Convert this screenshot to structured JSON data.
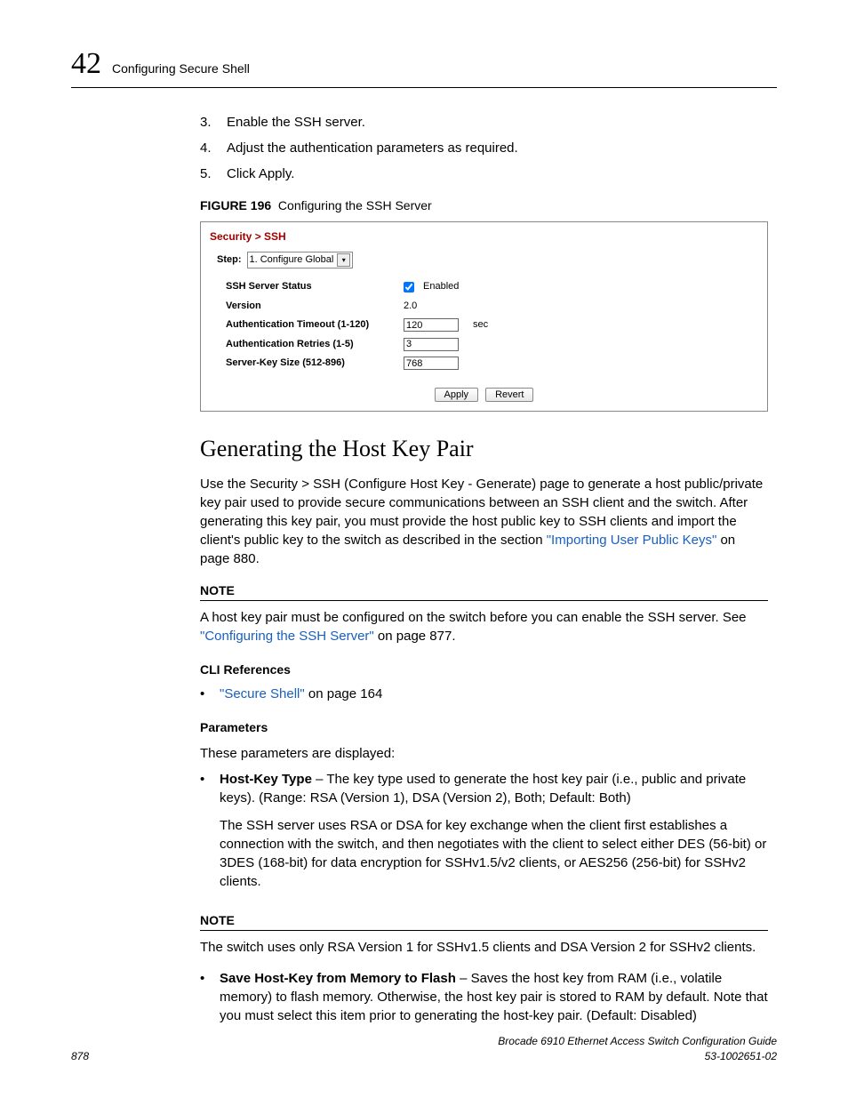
{
  "header": {
    "chapter_number": "42",
    "chapter_title": "Configuring Secure Shell"
  },
  "steps": [
    {
      "num": "3.",
      "text": "Enable the SSH server."
    },
    {
      "num": "4.",
      "text": "Adjust the authentication parameters as required."
    },
    {
      "num": "5.",
      "text": "Click Apply."
    }
  ],
  "figure": {
    "label": "FIGURE 196",
    "caption": "Configuring the SSH Server"
  },
  "shot": {
    "breadcrumb": "Security > SSH",
    "step_label": "Step:",
    "step_value": "1. Configure Global",
    "fields": {
      "status_label": "SSH Server Status",
      "status_enabled_label": "Enabled",
      "version_label": "Version",
      "version_value": "2.0",
      "timeout_label": "Authentication Timeout (1-120)",
      "timeout_value": "120",
      "timeout_unit": "sec",
      "retries_label": "Authentication Retries (1-5)",
      "retries_value": "3",
      "keysize_label": "Server-Key Size (512-896)",
      "keysize_value": "768"
    },
    "buttons": {
      "apply": "Apply",
      "revert": "Revert"
    }
  },
  "section_title": "Generating the Host Key Pair",
  "intro_1": "Use the Security > SSH (Configure Host Key - Generate) page to generate a host public/private key pair used to provide secure communications between an SSH client and the switch. After generating this key pair, you must provide the host public key to SSH clients and import the client's public key to the switch as described in the section ",
  "intro_link": "\"Importing User Public Keys\"",
  "intro_2": " on page 880.",
  "note1": {
    "head": "NOTE",
    "text_1": "A host key pair must be configured on the switch before you can enable the SSH server. See ",
    "link": "\"Configuring the SSH Server\"",
    "text_2": " on page 877."
  },
  "cli": {
    "head": "CLI References",
    "link": "\"Secure Shell\"",
    "suffix": " on page 164"
  },
  "params": {
    "head": "Parameters",
    "intro": "These parameters are displayed:",
    "hktype_label": "Host-Key Type",
    "hktype_text": " – The key type used to generate the host key pair (i.e., public and private keys). (Range: RSA (Version 1), DSA (Version 2), Both; Default: Both)",
    "hktype_para2": "The SSH server uses RSA or DSA for key exchange when the client first establishes a connection with the switch, and then negotiates with the client to select either DES (56-bit) or 3DES (168-bit) for data encryption for SSHv1.5/v2 clients, or AES256 (256-bit) for SSHv2 clients."
  },
  "note2": {
    "head": "NOTE",
    "text": "The switch uses only RSA Version 1 for SSHv1.5 clients and DSA Version 2 for SSHv2 clients."
  },
  "save": {
    "label": "Save Host-Key from Memory to Flash",
    "text": " – Saves the host key from RAM (i.e., volatile memory) to flash memory. Otherwise, the host key pair is stored to RAM by default. Note that you must select this item prior to generating the host-key pair. (Default: Disabled)"
  },
  "footer": {
    "page": "878",
    "title": "Brocade 6910 Ethernet Access Switch Configuration Guide",
    "docno": "53-1002651-02"
  }
}
